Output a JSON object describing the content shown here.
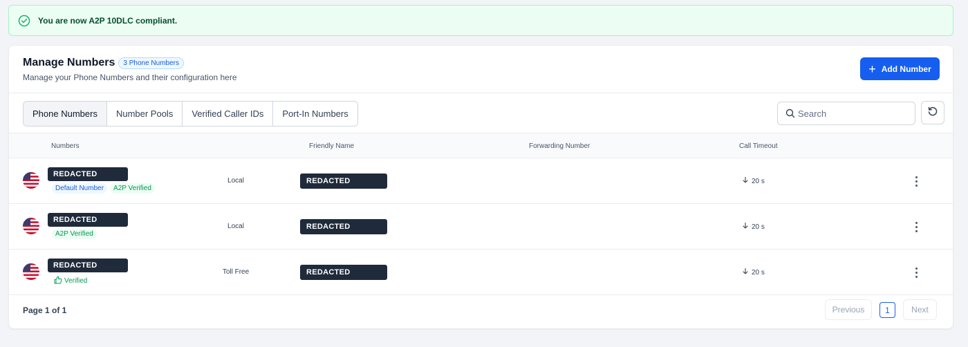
{
  "alert": {
    "text": "You are now A2P 10DLC compliant.",
    "icon": "check-circle-icon",
    "color": "#12b76a"
  },
  "header": {
    "title": "Manage Numbers",
    "count_badge": "3 Phone Numbers",
    "subtitle": "Manage your Phone Numbers and their configuration here",
    "add_button": "Add Number"
  },
  "tabs": [
    {
      "label": "Phone Numbers",
      "active": true
    },
    {
      "label": "Number Pools",
      "active": false
    },
    {
      "label": "Verified Caller IDs",
      "active": false
    },
    {
      "label": "Port-In Numbers",
      "active": false
    }
  ],
  "search": {
    "placeholder": "Search",
    "value": ""
  },
  "table": {
    "columns": [
      "Numbers",
      "Friendly Name",
      "Forwarding Number",
      "Call Timeout"
    ],
    "rows": [
      {
        "number": "REDACTED",
        "tags": [
          "Default Number",
          "A2P Verified"
        ],
        "type": "Local",
        "friendly_name": "REDACTED",
        "forwarding_number": "",
        "timeout": "20 s"
      },
      {
        "number": "REDACTED",
        "tags": [
          "A2P Verified"
        ],
        "type": "Local",
        "friendly_name": "REDACTED",
        "forwarding_number": "",
        "timeout": "20 s"
      },
      {
        "number": "REDACTED",
        "tags": [
          "Verified"
        ],
        "type": "Toll Free",
        "friendly_name": "REDACTED",
        "forwarding_number": "",
        "timeout": "20 s"
      }
    ]
  },
  "pagination": {
    "info": "Page 1 of 1",
    "previous": "Previous",
    "current": "1",
    "next": "Next"
  },
  "colors": {
    "primary": "#155eef",
    "success": "#039855",
    "redacted": "#1f2a3a"
  }
}
